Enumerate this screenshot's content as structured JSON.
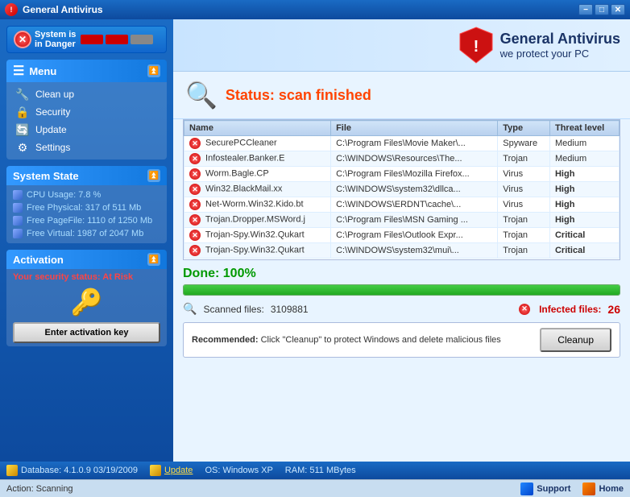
{
  "titleBar": {
    "title": "General Antivirus",
    "minBtn": "−",
    "maxBtn": "□",
    "closeBtn": "✕"
  },
  "dangerBanner": {
    "text": "System is\nin Danger"
  },
  "menu": {
    "header": "Menu",
    "items": [
      {
        "label": "Clean up",
        "icon": "🔧"
      },
      {
        "label": "Security",
        "icon": "🔒"
      },
      {
        "label": "Update",
        "icon": "🔄"
      },
      {
        "label": "Settings",
        "icon": "⚙"
      }
    ]
  },
  "systemState": {
    "header": "System State",
    "items": [
      {
        "label": "CPU Usage: 7.8 %"
      },
      {
        "label": "Free Physical: 317 of 511 Mb"
      },
      {
        "label": "Free PageFile: 1110 of 1250 Mb"
      },
      {
        "label": "Free Virtual: 1987 of 2047 Mb"
      }
    ]
  },
  "activation": {
    "header": "Activation",
    "statusText": "Your security status: ",
    "statusValue": "At Risk",
    "buttonLabel": "Enter activation key"
  },
  "logo": {
    "brandName": "General Antivirus",
    "tagline": "we protect your PC"
  },
  "status": {
    "prefix": "Status: ",
    "value": "scan finished"
  },
  "tableHeaders": [
    "Name",
    "File",
    "Type",
    "Threat level"
  ],
  "tableRows": [
    {
      "name": "SecurePCCleaner",
      "file": "C:\\Program Files\\Movie Maker\\...",
      "type": "Spyware",
      "threat": "Medium",
      "threatClass": "threat-medium"
    },
    {
      "name": "Infostealer.Banker.E",
      "file": "C:\\WINDOWS\\Resources\\The...",
      "type": "Trojan",
      "threat": "Medium",
      "threatClass": "threat-medium"
    },
    {
      "name": "Worm.Bagle.CP",
      "file": "C:\\Program Files\\Mozilla Firefox...",
      "type": "Virus",
      "threat": "High",
      "threatClass": "threat-high"
    },
    {
      "name": "Win32.BlackMail.xx",
      "file": "C:\\WINDOWS\\system32\\dllca...",
      "type": "Virus",
      "threat": "High",
      "threatClass": "threat-high"
    },
    {
      "name": "Net-Worm.Win32.Kido.bt",
      "file": "C:\\WINDOWS\\ERDNT\\cache\\...",
      "type": "Virus",
      "threat": "High",
      "threatClass": "threat-high"
    },
    {
      "name": "Trojan.Dropper.MSWord.j",
      "file": "C:\\Program Files\\MSN Gaming ...",
      "type": "Trojan",
      "threat": "High",
      "threatClass": "threat-high"
    },
    {
      "name": "Trojan-Spy.Win32.Qukart",
      "file": "C:\\Program Files\\Outlook Expr...",
      "type": "Trojan",
      "threat": "Critical",
      "threatClass": "threat-critical"
    },
    {
      "name": "Trojan-Spy.Win32.Qukart",
      "file": "C:\\WINDOWS\\system32\\mui\\...",
      "type": "Trojan",
      "threat": "Critical",
      "threatClass": "threat-critical"
    }
  ],
  "done": {
    "label": "Done: ",
    "value": "100%"
  },
  "scannedFiles": {
    "label": "Scanned files:",
    "value": "3109881"
  },
  "infectedFiles": {
    "label": "Infected files:",
    "value": "26"
  },
  "recommended": {
    "prefix": "Recommended: ",
    "text": "Click \"Cleanup\" to\nprotect Windows and delete malicious files",
    "buttonLabel": "Cleanup"
  },
  "footer": {
    "database": "Database:  4.1.0.9  03/19/2009",
    "updateLabel": "Update",
    "os": "OS:  Windows XP",
    "ram": "RAM:  511 MBytes"
  },
  "actionBar": {
    "actionText": "Action: Scanning",
    "support": "Support",
    "home": "Home"
  }
}
